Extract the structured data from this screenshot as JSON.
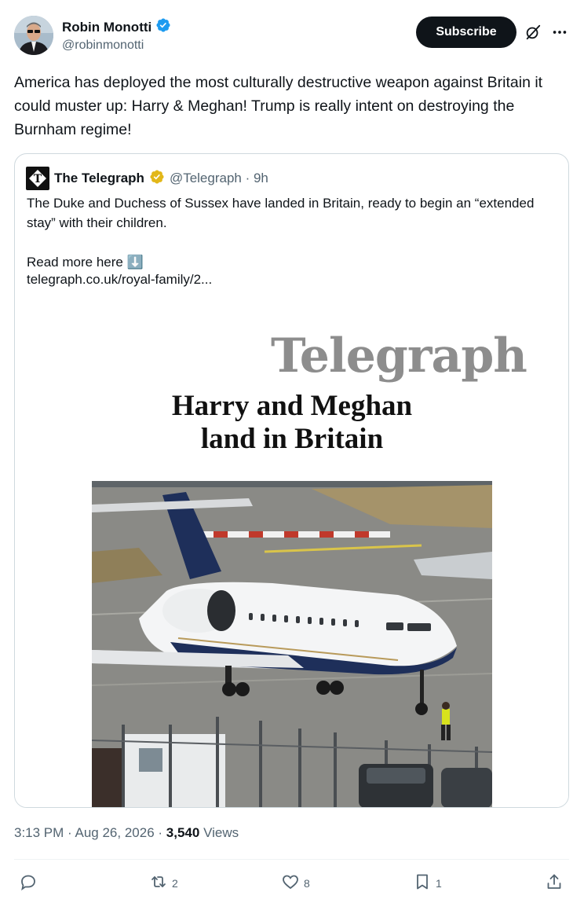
{
  "author": {
    "display_name": "Robin Monotti",
    "handle": "@robinmonotti",
    "verified": true
  },
  "header": {
    "subscribe_label": "Subscribe"
  },
  "tweet": {
    "text": "America has deployed the most culturally destructive weapon against Britain it could muster up: Harry & Meghan! Trump is really intent on destroying the Burnham regime!"
  },
  "quote": {
    "display_name": "The Telegraph",
    "handle_time": "@Telegraph · 9h",
    "text": "The Duke and Duchess of Sussex have landed in Britain, ready to begin an “extended stay” with their children.\n\nRead more here ⬇️",
    "link": "telegraph.co.uk/royal-family/2...",
    "media": {
      "brand": "Telegraph",
      "headline": "Harry and Meghan\nland in Britain"
    }
  },
  "meta": {
    "time": "3:13 PM",
    "date": "Aug 26, 2026",
    "views_count": "3,540",
    "views_label": "Views"
  },
  "actions": {
    "reply_count": "",
    "repost_count": "2",
    "like_count": "8",
    "bookmark_count": "1"
  },
  "colors": {
    "text_primary": "#0f1419",
    "text_secondary": "#536471",
    "verified_blue": "#1d9bf0",
    "verified_gold": "#e2b719",
    "border": "#cfd9de"
  }
}
